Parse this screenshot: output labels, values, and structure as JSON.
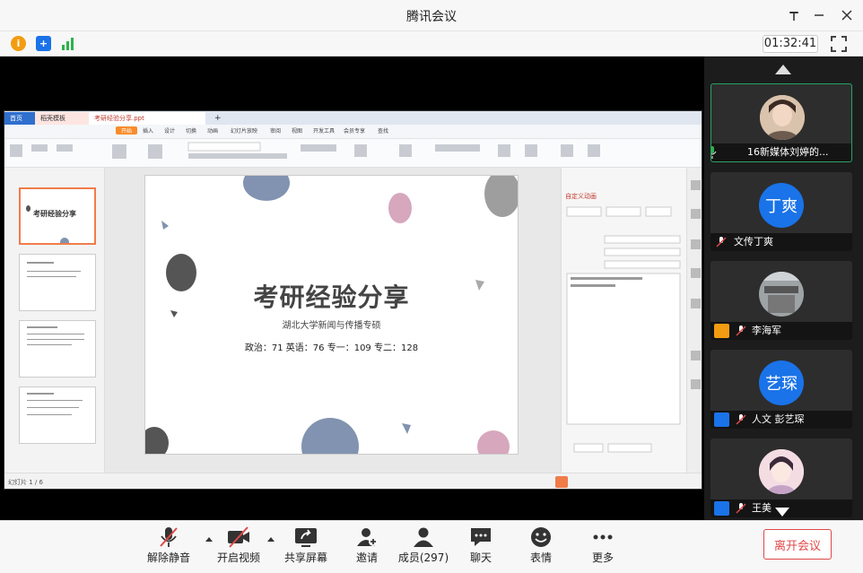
{
  "window": {
    "title": "腾讯会议"
  },
  "status": {
    "timer": "01:32:41"
  },
  "share": {
    "ppt": {
      "tabs": [
        "首页",
        "稻壳模板",
        "考研经验分享.ppt"
      ],
      "menus": [
        "开始",
        "插入",
        "设计",
        "切换",
        "动画",
        "幻灯片放映",
        "审阅",
        "视图",
        "开发工具",
        "会员专享",
        "查找"
      ],
      "slide": {
        "title": "考研经验分享",
        "subtitle": "湖北大学新闻与传播专硕",
        "scores": "政治：71 英语：76  专一：109  专二：128"
      },
      "panel_title": "自定义动画",
      "status_left": "幻灯片 1 / 6"
    }
  },
  "participants": [
    {
      "name": "16新媒体刘婷的...",
      "avatar_text": "",
      "photo": true
    },
    {
      "name": "文传丁爽",
      "avatar_text": "丁爽",
      "photo": false
    },
    {
      "name": "李海军",
      "avatar_text": "",
      "photo": true
    },
    {
      "name": "人文 彭艺琛",
      "avatar_text": "艺琛",
      "photo": false
    },
    {
      "name": "王美",
      "avatar_text": "",
      "photo": true
    }
  ],
  "toolbar": {
    "mute": "解除静音",
    "video": "开启视频",
    "share": "共享屏幕",
    "invite": "邀请",
    "members": "成员(297)",
    "chat": "聊天",
    "emoji": "表情",
    "more": "更多",
    "leave": "离开会议"
  },
  "colors": {
    "accent": "#1a73e8",
    "danger": "#e04848",
    "active_border": "#27a366"
  }
}
